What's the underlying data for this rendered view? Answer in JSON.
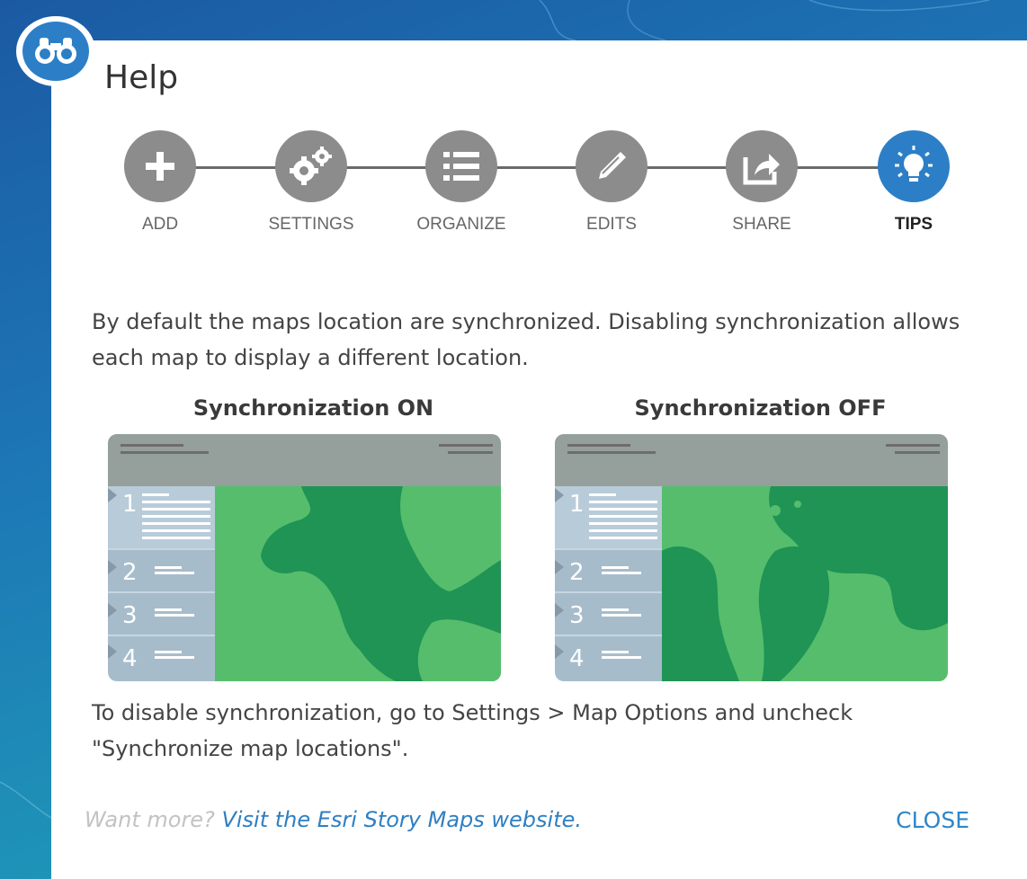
{
  "dialog": {
    "title": "Help",
    "header_icon": "binoculars-icon"
  },
  "steps": [
    {
      "label": "ADD",
      "icon": "plus-icon",
      "active": false
    },
    {
      "label": "SETTINGS",
      "icon": "gears-icon",
      "active": false
    },
    {
      "label": "ORGANIZE",
      "icon": "list-icon",
      "active": false
    },
    {
      "label": "EDITS",
      "icon": "pencil-icon",
      "active": false
    },
    {
      "label": "SHARE",
      "icon": "share-icon",
      "active": false
    },
    {
      "label": "TIPS",
      "icon": "lightbulb-icon",
      "active": true
    }
  ],
  "content": {
    "intro": "By default the maps location are synchronized. Disabling synchronization allows each map to display a different location.",
    "caption_on": "Synchronization ON",
    "caption_off": "Synchronization OFF",
    "instructions": "To disable synchronization, go to Settings > Map Options and uncheck \"Synchronize map locations\".",
    "illustration_numbers": [
      "1",
      "2",
      "3",
      "4"
    ]
  },
  "footer": {
    "want_more": "Want more?",
    "link": "Visit the Esri Story Maps website.",
    "close": "CLOSE"
  },
  "colors": {
    "accent": "#2c7fc6",
    "step_inactive": "#8c8c8c",
    "map_land_dark": "#1f9454",
    "map_land_light": "#56bd6c",
    "sidebar": "#a7bccb"
  }
}
